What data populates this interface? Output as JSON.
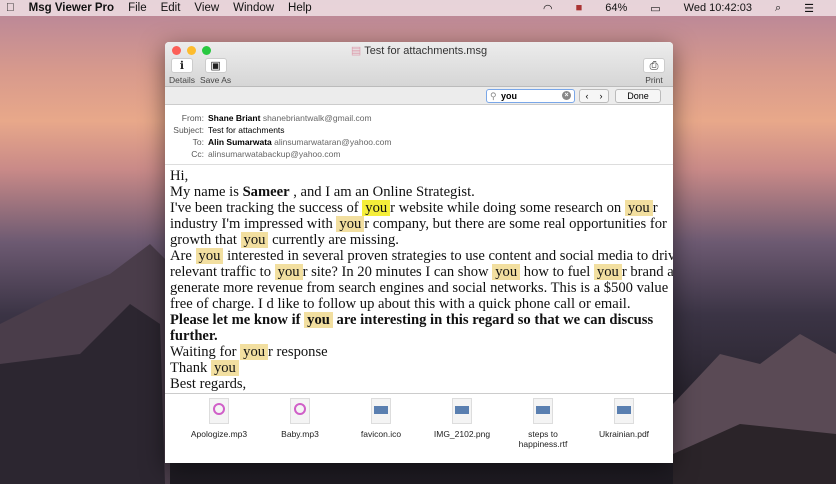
{
  "menubar": {
    "app": "Msg Viewer Pro",
    "items": [
      "File",
      "Edit",
      "View",
      "Window",
      "Help"
    ],
    "battery": "64%",
    "clock": "Wed 10:42:03"
  },
  "window": {
    "title": "Test for attachments.msg",
    "toolbar": {
      "details": "Details",
      "save_as": "Save As",
      "print": "Print"
    },
    "find": {
      "query": "you",
      "done": "Done"
    },
    "header": {
      "from_label": "From:",
      "from_name": "Shane Briant",
      "from_email": "shanebriantwalk@gmail.com",
      "subject_label": "Subject:",
      "subject": "Test for attachments",
      "to_label": "To:",
      "to_name": "Alin Sumarwata",
      "to_email": "alinsumarwataran@yahoo.com",
      "cc_label": "Cc:",
      "cc_email": "alinsumarwatabackup@yahoo.com"
    },
    "body": [
      [
        {
          "t": "Hi,"
        }
      ],
      [
        {
          "t": "My name is "
        },
        {
          "t": "Sameer",
          "b": 1
        },
        {
          "t": " , and I am an Online Strategist."
        }
      ],
      [
        {
          "t": "I've been tracking the success of "
        },
        {
          "t": "you",
          "h": 2
        },
        {
          "t": "r website while doing some research on "
        },
        {
          "t": "you",
          "h": 1
        },
        {
          "t": "r"
        }
      ],
      [
        {
          "t": "industry I'm impressed with "
        },
        {
          "t": "you",
          "h": 1
        },
        {
          "t": "r company, but there are some real opportunities for"
        }
      ],
      [
        {
          "t": "growth that "
        },
        {
          "t": "you",
          "h": 1
        },
        {
          "t": " currently are missing."
        }
      ],
      [
        {
          "t": "Are "
        },
        {
          "t": "you",
          "h": 1
        },
        {
          "t": " interested in several proven strategies to use content and social media to drive"
        }
      ],
      [
        {
          "t": "relevant traffic to "
        },
        {
          "t": "you",
          "h": 1
        },
        {
          "t": "r site? In 20 minutes I can show "
        },
        {
          "t": "you",
          "h": 1
        },
        {
          "t": " how to fuel "
        },
        {
          "t": "you",
          "h": 1
        },
        {
          "t": "r brand and"
        }
      ],
      [
        {
          "t": "generate more revenue from search engines and social networks. This is a $500 value"
        }
      ],
      [
        {
          "t": "free of charge. I d like to follow up about this with a quick phone call or email."
        }
      ],
      [
        {
          "t": "Please let me know if ",
          "b": 1
        },
        {
          "t": "you",
          "h": 1,
          "b": 1
        },
        {
          "t": " are interesting in this regard so that we can discuss",
          "b": 1
        }
      ],
      [
        {
          "t": "further.",
          "b": 1
        }
      ],
      [
        {
          "t": "Waiting for "
        },
        {
          "t": "you",
          "h": 1
        },
        {
          "t": "r response"
        }
      ],
      [
        {
          "t": "Thank "
        },
        {
          "t": "you",
          "h": 1
        }
      ],
      [
        {
          "t": "Best regards,"
        }
      ]
    ],
    "attachments": [
      {
        "name": "Apologize.mp3",
        "type": "MP3"
      },
      {
        "name": "Baby.mp3",
        "type": "MP3"
      },
      {
        "name": "favicon.ico",
        "type": "ICO"
      },
      {
        "name": "IMG_2102.png",
        "type": "PNG"
      },
      {
        "name": "steps to happiness.rtf",
        "type": "RTF"
      },
      {
        "name": "Ukrainian.pdf",
        "type": "PDF"
      }
    ]
  }
}
